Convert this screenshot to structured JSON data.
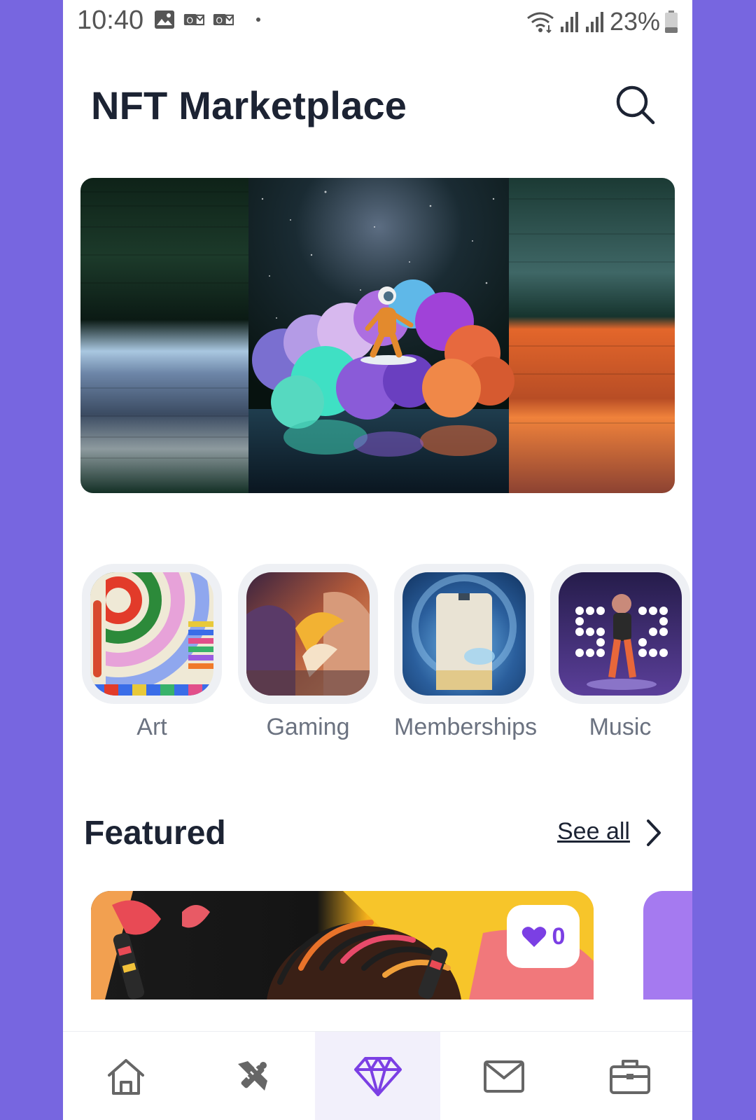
{
  "status_bar": {
    "time": "10:40",
    "battery": "23%"
  },
  "header": {
    "title": "NFT Marketplace"
  },
  "categories": [
    {
      "label": "Art"
    },
    {
      "label": "Gaming"
    },
    {
      "label": "Memberships"
    },
    {
      "label": "Music"
    }
  ],
  "featured": {
    "title": "Featured",
    "see_all": "See all",
    "card": {
      "likes": "0"
    }
  },
  "bottom_nav": {
    "items": [
      {
        "icon": "home-icon"
      },
      {
        "icon": "tools-icon"
      },
      {
        "icon": "diamond-icon",
        "active": true
      },
      {
        "icon": "mail-icon"
      },
      {
        "icon": "briefcase-icon"
      }
    ]
  },
  "colors": {
    "accent": "#7b3fe4",
    "frame": "#7766e0",
    "text_dark": "#1c2333",
    "text_muted": "#6b7280"
  }
}
